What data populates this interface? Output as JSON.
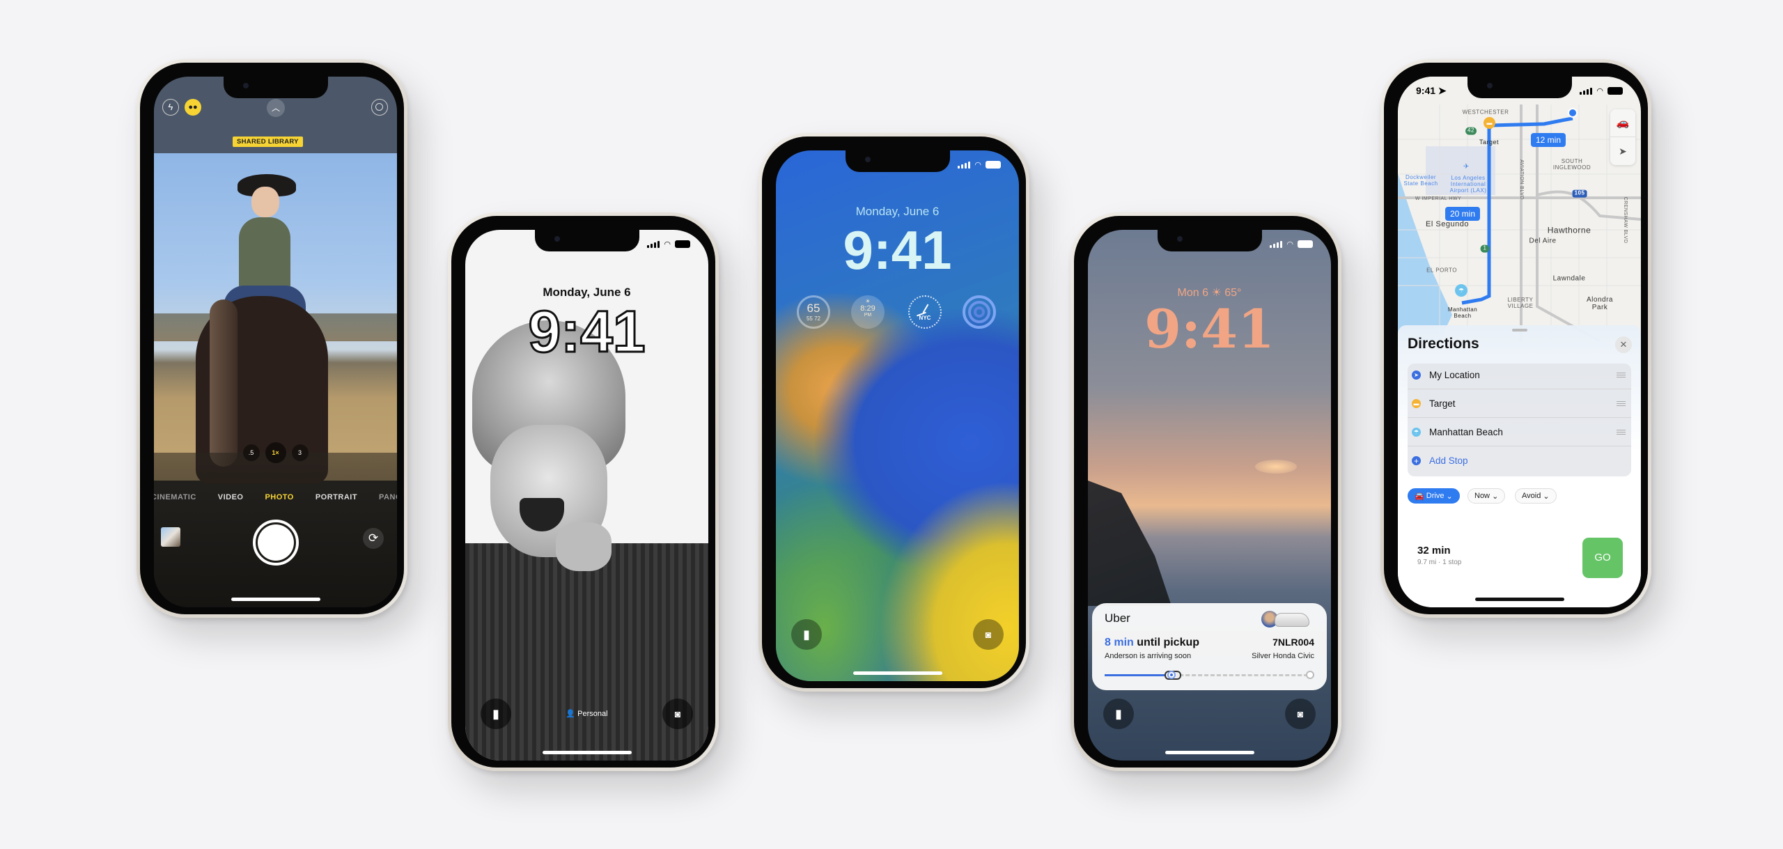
{
  "camera_phone": {
    "shared_library_badge": "SHARED LIBRARY",
    "zoom_levels": [
      ".5",
      "1×",
      "3"
    ],
    "modes": [
      "CINEMATIC",
      "VIDEO",
      "PHOTO",
      "PORTRAIT",
      "PANO"
    ],
    "active_mode": "PHOTO",
    "icons": [
      "flash-icon",
      "shared-library-icon",
      "chevron-up-icon",
      "live-photo-icon",
      "shutter-icon",
      "flip-camera-icon"
    ],
    "accent": "#f7d434"
  },
  "portrait_phone": {
    "date": "Monday, June 6",
    "time": "9:41",
    "focus_label": "Personal"
  },
  "wallpaper_phone": {
    "date": "Monday, June 6",
    "time": "9:41",
    "widgets": {
      "weather_temp": "65",
      "weather_low": "55",
      "weather_high": "72",
      "sunset_time": "8:29",
      "sunset_period": "PM",
      "clock_city": "NYC"
    }
  },
  "sunset_phone": {
    "date": "Mon 6",
    "temp": "65°",
    "time": "9:41",
    "time_color": "#f2a584",
    "uber": {
      "app": "Uber",
      "eta": "8 min",
      "eta_suffix": " until pickup",
      "subtitle": "Anderson is arriving soon",
      "plate": "7NLR004",
      "car": "Silver Honda Civic",
      "progress": 0.3
    }
  },
  "maps_phone": {
    "status_time": "9:41",
    "map_labels": {
      "westchester": "WESTCHESTER",
      "target": "Target",
      "south_inglewood": "SOUTH INGLEWOOD",
      "dockweiler": "Dockweiler State Beach",
      "lax": "Los Angeles International Airport (LAX)",
      "aviation": "AVIATION BLVD",
      "imperial": "W IMPERIAL HWY",
      "hwy105": "105",
      "hwy42": "42",
      "hwy1": "1",
      "el_segundo": "El Segundo",
      "hawthorne": "Hawthorne",
      "del_aire": "Del Aire",
      "crenshaw": "CRENSHAW BLVD",
      "el_porto": "EL PORTO",
      "lawndale": "Lawndale",
      "liberty_village": "LIBERTY VILLAGE",
      "alondra_park": "Alondra Park",
      "manhattan_beach": "Manhattan Beach"
    },
    "eta_badges": [
      "12 min",
      "20 min"
    ],
    "directions": {
      "title": "Directions",
      "stops": [
        "My Location",
        "Target",
        "Manhattan Beach"
      ],
      "add_stop": "Add Stop",
      "chips": [
        "Drive",
        "Now",
        "Avoid"
      ],
      "duration": "32 min",
      "summary": "9.7 mi · 1 stop",
      "go": "GO"
    },
    "route_color": "#2f7bf0",
    "go_color": "#65c466"
  }
}
